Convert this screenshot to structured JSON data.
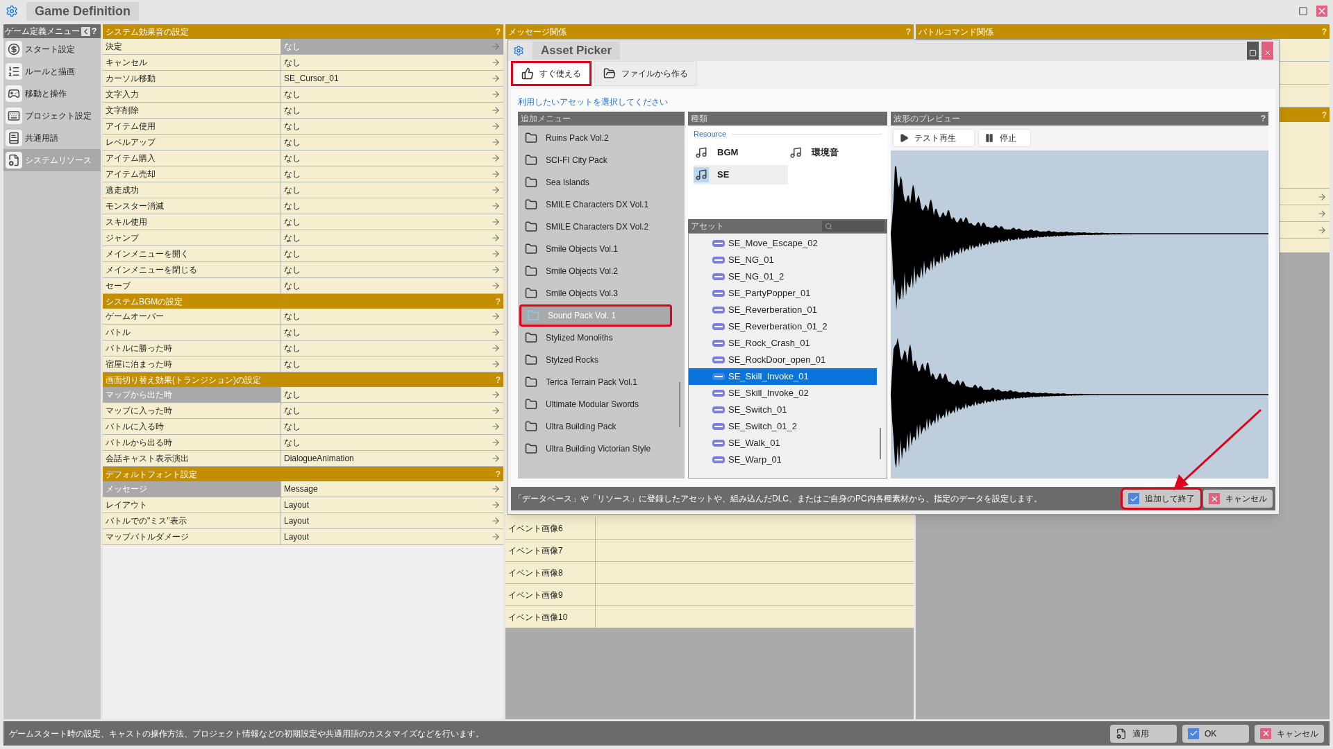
{
  "window": {
    "title": "Game Definition"
  },
  "sidebar": {
    "title": "ゲーム定義メニュー",
    "help": "?",
    "items": [
      {
        "label": "スタート設定",
        "kind": "start",
        "selected": false
      },
      {
        "label": "ルールと描画",
        "kind": "rules",
        "selected": false
      },
      {
        "label": "移動と操作",
        "kind": "controls",
        "selected": false
      },
      {
        "label": "プロジェクト設定",
        "kind": "project",
        "selected": false
      },
      {
        "label": "共通用語",
        "kind": "terms",
        "selected": false
      },
      {
        "label": "システムリソース",
        "kind": "resources",
        "selected": true
      }
    ]
  },
  "settings": {
    "sections": [
      {
        "title": "システム効果音の設定",
        "help": "?",
        "rows": [
          {
            "label": "決定",
            "value": "なし",
            "label_selected": false,
            "value_selected": true
          },
          {
            "label": "キャンセル",
            "value": "なし",
            "label_selected": false,
            "value_selected": false
          },
          {
            "label": "カーソル移動",
            "value": "SE_Cursor_01",
            "label_selected": false,
            "value_selected": false
          },
          {
            "label": "文字入力",
            "value": "なし",
            "label_selected": false,
            "value_selected": false
          },
          {
            "label": "文字削除",
            "value": "なし",
            "label_selected": false,
            "value_selected": false
          },
          {
            "label": "アイテム使用",
            "value": "なし",
            "label_selected": false,
            "value_selected": false
          },
          {
            "label": "レベルアップ",
            "value": "なし",
            "label_selected": false,
            "value_selected": false
          },
          {
            "label": "アイテム購入",
            "value": "なし",
            "label_selected": false,
            "value_selected": false
          },
          {
            "label": "アイテム売却",
            "value": "なし",
            "label_selected": false,
            "value_selected": false
          },
          {
            "label": "逃走成功",
            "value": "なし",
            "label_selected": false,
            "value_selected": false
          },
          {
            "label": "モンスター消滅",
            "value": "なし",
            "label_selected": false,
            "value_selected": false
          },
          {
            "label": "スキル使用",
            "value": "なし",
            "label_selected": false,
            "value_selected": false
          },
          {
            "label": "ジャンプ",
            "value": "なし",
            "label_selected": false,
            "value_selected": false
          },
          {
            "label": "メインメニューを開く",
            "value": "なし",
            "label_selected": false,
            "value_selected": false
          },
          {
            "label": "メインメニューを閉じる",
            "value": "なし",
            "label_selected": false,
            "value_selected": false
          },
          {
            "label": "セーブ",
            "value": "なし",
            "label_selected": false,
            "value_selected": false
          }
        ]
      },
      {
        "title": "システムBGMの設定",
        "help": "?",
        "rows": [
          {
            "label": "ゲームオーバー",
            "value": "なし",
            "label_selected": false,
            "value_selected": false
          },
          {
            "label": "バトル",
            "value": "なし",
            "label_selected": false,
            "value_selected": false
          },
          {
            "label": "バトルに勝った時",
            "value": "なし",
            "label_selected": false,
            "value_selected": false
          },
          {
            "label": "宿屋に泊まった時",
            "value": "なし",
            "label_selected": false,
            "value_selected": false
          }
        ]
      },
      {
        "title": "画面切り替え効果(トランジション)の設定",
        "help": "?",
        "rows": [
          {
            "label": "マップから出た時",
            "value": "なし",
            "label_selected": true,
            "value_selected": false
          },
          {
            "label": "マップに入った時",
            "value": "なし",
            "label_selected": false,
            "value_selected": false
          },
          {
            "label": "バトルに入る時",
            "value": "なし",
            "label_selected": false,
            "value_selected": false
          },
          {
            "label": "バトルから出る時",
            "value": "なし",
            "label_selected": false,
            "value_selected": false
          },
          {
            "label": "会話キャスト表示演出",
            "value": "DialogueAnimation",
            "label_selected": false,
            "value_selected": false
          }
        ]
      },
      {
        "title": "デフォルトフォント設定",
        "help": "?",
        "rows": [
          {
            "label": "メッセージ",
            "value": "Message",
            "label_selected": true,
            "value_selected": false
          },
          {
            "label": "レイアウト",
            "value": "Layout",
            "label_selected": false,
            "value_selected": false
          },
          {
            "label": "バトルでの\"ミス\"表示",
            "value": "Layout",
            "label_selected": false,
            "value_selected": false
          },
          {
            "label": "マップバトルダメージ",
            "value": "Layout",
            "label_selected": false,
            "value_selected": false
          }
        ]
      }
    ]
  },
  "message_panel": {
    "title": "メッセージ関係",
    "help": "?",
    "rows": [
      {
        "label": "イベント画像6"
      },
      {
        "label": "イベント画像7"
      },
      {
        "label": "イベント画像8"
      },
      {
        "label": "イベント画像9"
      },
      {
        "label": "イベント画像10"
      }
    ]
  },
  "battle_panel": {
    "title": "バトルコマンド関係",
    "help": "?",
    "section_help": "?"
  },
  "dialog": {
    "title": "Asset Picker",
    "tabs": [
      {
        "label": "すぐ使える",
        "kind": "ready",
        "selected": true,
        "annotated": true
      },
      {
        "label": "ファイルから作る",
        "kind": "file",
        "selected": false,
        "annotated": false
      }
    ],
    "instruction": "利用したいアセットを選択してください",
    "menu": {
      "title": "追加メニュー",
      "items": [
        {
          "label": "Ruins Pack Vol.2",
          "selected": false,
          "annotated": false
        },
        {
          "label": "SCI-FI City Pack",
          "selected": false,
          "annotated": false
        },
        {
          "label": "Sea Islands",
          "selected": false,
          "annotated": false
        },
        {
          "label": "SMILE Characters DX Vol.1",
          "selected": false,
          "annotated": false
        },
        {
          "label": "SMILE Characters DX Vol.2",
          "selected": false,
          "annotated": false
        },
        {
          "label": "Smile Objects Vol.1",
          "selected": false,
          "annotated": false
        },
        {
          "label": "Smile Objects Vol.2",
          "selected": false,
          "annotated": false
        },
        {
          "label": "Smile Objects Vol.3",
          "selected": false,
          "annotated": false
        },
        {
          "label": "Sound Pack Vol. 1",
          "selected": true,
          "annotated": true
        },
        {
          "label": "Stylized Monoliths",
          "selected": false,
          "annotated": false
        },
        {
          "label": "Stylzed Rocks",
          "selected": false,
          "annotated": false
        },
        {
          "label": "Terica Terrain Pack Vol.1",
          "selected": false,
          "annotated": false
        },
        {
          "label": "Ultimate Modular Swords",
          "selected": false,
          "annotated": false
        },
        {
          "label": "Ultra Building Pack",
          "selected": false,
          "annotated": false
        },
        {
          "label": "Ultra Building Victorian Style",
          "selected": false,
          "annotated": false
        }
      ]
    },
    "types": {
      "title": "種類",
      "group": "Resource",
      "items": [
        {
          "label": "BGM",
          "selected": false
        },
        {
          "label": "環境音",
          "selected": false
        },
        {
          "label": "SE",
          "selected": true
        }
      ]
    },
    "assets": {
      "title": "アセット",
      "items": [
        {
          "label": "SE_Move_Escape_02",
          "selected": false
        },
        {
          "label": "SE_NG_01",
          "selected": false
        },
        {
          "label": "SE_NG_01_2",
          "selected": false
        },
        {
          "label": "SE_PartyPopper_01",
          "selected": false
        },
        {
          "label": "SE_Reverberation_01",
          "selected": false
        },
        {
          "label": "SE_Reverberation_01_2",
          "selected": false
        },
        {
          "label": "SE_Rock_Crash_01",
          "selected": false
        },
        {
          "label": "SE_RockDoor_open_01",
          "selected": false
        },
        {
          "label": "SE_Skill_Invoke_01",
          "selected": true
        },
        {
          "label": "SE_Skill_Invoke_02",
          "selected": false
        },
        {
          "label": "SE_Switch_01",
          "selected": false
        },
        {
          "label": "SE_Switch_01_2",
          "selected": false
        },
        {
          "label": "SE_Walk_01",
          "selected": false
        },
        {
          "label": "SE_Warp_01",
          "selected": false
        }
      ]
    },
    "preview": {
      "title": "波形のプレビュー",
      "help": "?",
      "play": "テスト再生",
      "stop": "停止"
    },
    "footer": "「データベース」や「リソース」に登録したアセットや、組み込んだDLC、またはご自身のPC内各種素材から、指定のデータを設定します。",
    "buttons": [
      {
        "label": "追加して終了",
        "kind": "confirm",
        "annotated": true
      },
      {
        "label": "キャンセル",
        "kind": "cancel",
        "annotated": false
      }
    ]
  },
  "status_bar": {
    "text": "ゲームスタート時の設定、キャストの操作方法、プロジェクト情報などの初期設定や共通用語のカスタマイズなどを行います。",
    "buttons": [
      {
        "label": "適用",
        "kind": "apply"
      },
      {
        "label": "OK",
        "kind": "confirm"
      },
      {
        "label": "キャンセル",
        "kind": "cancel"
      }
    ]
  }
}
